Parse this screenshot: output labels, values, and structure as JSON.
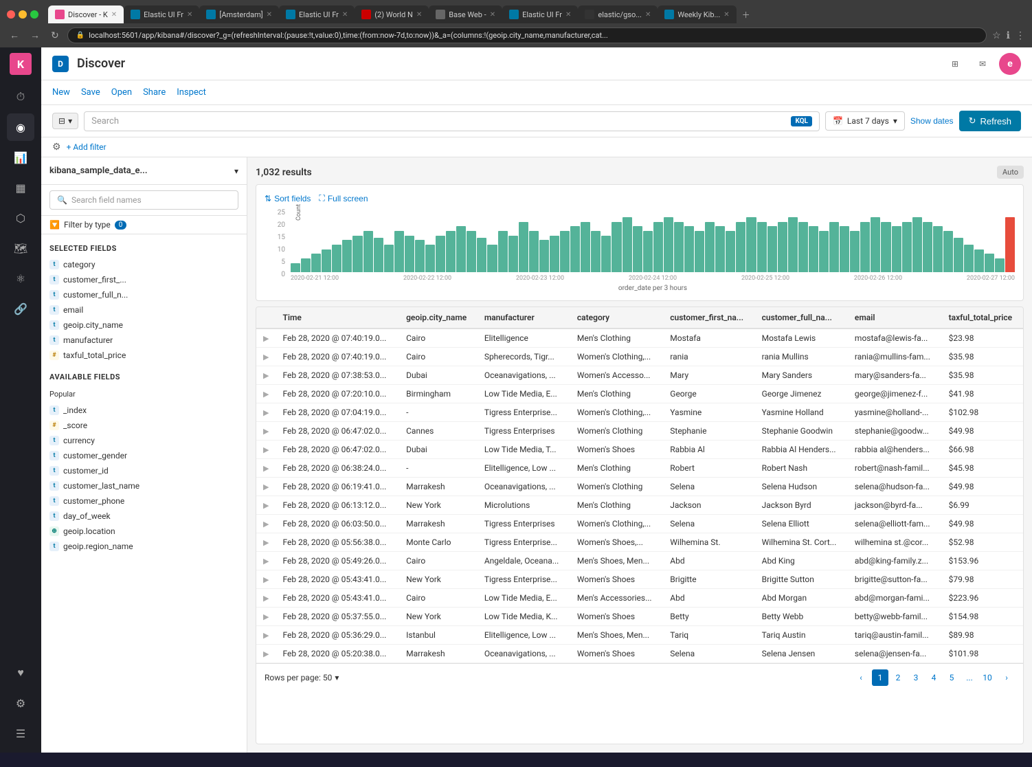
{
  "browser": {
    "url": "localhost:5601/app/kibana#/discover?_g=(refreshInterval:(pause:!t,value:0),time:(from:now-7d,to:now))&_a=(columns:!(geoip.city_name,manufacturer,cat...",
    "tabs": [
      {
        "label": "Discover - K",
        "favicon_color": "#e8478c",
        "active": true
      },
      {
        "label": "Elastic UI Fr",
        "favicon_color": "#0079a5",
        "active": false
      },
      {
        "label": "[Amsterdam]",
        "favicon_color": "#0079a5",
        "active": false
      },
      {
        "label": "Elastic UI Fr",
        "favicon_color": "#0079a5",
        "active": false
      },
      {
        "label": "(2) World N",
        "favicon_color": "#cc0000",
        "active": false
      },
      {
        "label": "Base Web -",
        "favicon_color": "#333",
        "active": false
      },
      {
        "label": "Elastic UI Fr",
        "favicon_color": "#0079a5",
        "active": false
      },
      {
        "label": "elastic/gso...",
        "favicon_color": "#333",
        "active": false
      },
      {
        "label": "Weekly Kib...",
        "favicon_color": "#0079a5",
        "active": false
      }
    ]
  },
  "app": {
    "title": "Discover",
    "nav_links": [
      "New",
      "Save",
      "Open",
      "Share",
      "Inspect"
    ],
    "search_placeholder": "Search",
    "kql_label": "KQL",
    "time_range": "Last 7 days",
    "show_dates_label": "Show dates",
    "refresh_label": "Refresh",
    "add_filter_label": "+ Add filter"
  },
  "sidebar": {
    "index_name": "kibana_sample_data_e...",
    "search_placeholder": "Search field names",
    "filter_type_label": "Filter by type",
    "filter_count": "0",
    "selected_fields_title": "Selected fields",
    "selected_fields": [
      {
        "name": "category",
        "type": "t"
      },
      {
        "name": "customer_first_...",
        "type": "t"
      },
      {
        "name": "customer_full_n...",
        "type": "t"
      },
      {
        "name": "email",
        "type": "t"
      },
      {
        "name": "geoip.city_name",
        "type": "t"
      },
      {
        "name": "manufacturer",
        "type": "t"
      },
      {
        "name": "taxful_total_price",
        "type": "hash"
      }
    ],
    "available_fields_title": "Available fields",
    "popular_title": "Popular",
    "popular_fields": [
      {
        "name": "_index",
        "type": "t"
      },
      {
        "name": "_score",
        "type": "hash"
      },
      {
        "name": "currency",
        "type": "t"
      },
      {
        "name": "customer_gender",
        "type": "t"
      },
      {
        "name": "customer_id",
        "type": "t"
      },
      {
        "name": "customer_last_name",
        "type": "t"
      },
      {
        "name": "customer_phone",
        "type": "t"
      },
      {
        "name": "day_of_week",
        "type": "t"
      },
      {
        "name": "geoip.location",
        "type": "geo"
      },
      {
        "name": "geoip.region_name",
        "type": "t"
      }
    ]
  },
  "results": {
    "count": "1,032 results",
    "auto_label": "Auto"
  },
  "chart": {
    "y_labels": [
      "25",
      "20",
      "15",
      "10",
      "5",
      "0"
    ],
    "x_labels": [
      "2020-02-21 12:00",
      "2020-02-22 12:00",
      "2020-02-23 12:00",
      "2020-02-24 12:00",
      "2020-02-25 12:00",
      "2020-02-26 12:00",
      "2020-02-27 12:00"
    ],
    "x_axis_label": "order_date per 3 hours",
    "y_axis_label": "Count",
    "sort_fields_label": "Sort fields",
    "full_screen_label": "Full screen",
    "bars": [
      4,
      6,
      8,
      10,
      12,
      14,
      16,
      18,
      15,
      12,
      18,
      16,
      14,
      12,
      16,
      18,
      20,
      18,
      15,
      12,
      18,
      16,
      22,
      18,
      14,
      16,
      18,
      20,
      22,
      18,
      16,
      22,
      24,
      20,
      18,
      22,
      24,
      22,
      20,
      18,
      22,
      20,
      18,
      22,
      24,
      22,
      20,
      22,
      24,
      22,
      20,
      18,
      22,
      20,
      18,
      22,
      24,
      22,
      20,
      22,
      24,
      22,
      20,
      18,
      15,
      12,
      10,
      8,
      6,
      24
    ]
  },
  "table": {
    "columns": [
      "Time",
      "geoip.city_name",
      "manufacturer",
      "category",
      "customer_first_na...",
      "customer_full_na...",
      "email",
      "taxful_total_price"
    ],
    "rows": [
      [
        "Feb 28, 2020 @ 07:40:19.0...",
        "Cairo",
        "Elitelligence",
        "Men's Clothing",
        "Mostafa",
        "Mostafa Lewis",
        "mostafa@lewis-fa...",
        "$23.98"
      ],
      [
        "Feb 28, 2020 @ 07:40:19.0...",
        "Cairo",
        "Spherecords, Tigr...",
        "Women's Clothing,...",
        "rania",
        "rania Mullins",
        "rania@mullins-fam...",
        "$35.98"
      ],
      [
        "Feb 28, 2020 @ 07:38:53.0...",
        "Dubai",
        "Oceanavigations, ...",
        "Women's Accesso...",
        "Mary",
        "Mary Sanders",
        "mary@sanders-fa...",
        "$35.98"
      ],
      [
        "Feb 28, 2020 @ 07:20:10.0...",
        "Birmingham",
        "Low Tide Media, E...",
        "Men's Clothing",
        "George",
        "George Jimenez",
        "george@jimenez-f...",
        "$41.98"
      ],
      [
        "Feb 28, 2020 @ 07:04:19.0...",
        "-",
        "Tigress Enterprise...",
        "Women's Clothing,...",
        "Yasmine",
        "Yasmine Holland",
        "yasmine@holland-...",
        "$102.98"
      ],
      [
        "Feb 28, 2020 @ 06:47:02.0...",
        "Cannes",
        "Tigress Enterprises",
        "Women's Clothing",
        "Stephanie",
        "Stephanie Goodwin",
        "stephanie@goodw...",
        "$49.98"
      ],
      [
        "Feb 28, 2020 @ 06:47:02.0...",
        "Dubai",
        "Low Tide Media, T...",
        "Women's Shoes",
        "Rabbia Al",
        "Rabbia Al Henders...",
        "rabbia al@henders...",
        "$66.98"
      ],
      [
        "Feb 28, 2020 @ 06:38:24.0...",
        "-",
        "Elitelligence, Low ...",
        "Men's Clothing",
        "Robert",
        "Robert Nash",
        "robert@nash-famil...",
        "$45.98"
      ],
      [
        "Feb 28, 2020 @ 06:19:41.0...",
        "Marrakesh",
        "Oceanavigations, ...",
        "Women's Clothing",
        "Selena",
        "Selena Hudson",
        "selena@hudson-fa...",
        "$49.98"
      ],
      [
        "Feb 28, 2020 @ 06:13:12.0...",
        "New York",
        "Microlutions",
        "Men's Clothing",
        "Jackson",
        "Jackson Byrd",
        "jackson@byrd-fa...",
        "$6.99"
      ],
      [
        "Feb 28, 2020 @ 06:03:50.0...",
        "Marrakesh",
        "Tigress Enterprises",
        "Women's Clothing,...",
        "Selena",
        "Selena Elliott",
        "selena@elliott-fam...",
        "$49.98"
      ],
      [
        "Feb 28, 2020 @ 05:56:38.0...",
        "Monte Carlo",
        "Tigress Enterprise...",
        "Women's Shoes,...",
        "Wilhemina St.",
        "Wilhemina St. Cort...",
        "wilhemina st.@cor...",
        "$52.98"
      ],
      [
        "Feb 28, 2020 @ 05:49:26.0...",
        "Cairo",
        "Angeldale, Oceana...",
        "Men's Shoes, Men...",
        "Abd",
        "Abd King",
        "abd@king-family.z...",
        "$153.96"
      ],
      [
        "Feb 28, 2020 @ 05:43:41.0...",
        "New York",
        "Tigress Enterprise...",
        "Women's Shoes",
        "Brigitte",
        "Brigitte Sutton",
        "brigitte@sutton-fa...",
        "$79.98"
      ],
      [
        "Feb 28, 2020 @ 05:43:41.0...",
        "Cairo",
        "Low Tide Media, E...",
        "Men's Accessories...",
        "Abd",
        "Abd Morgan",
        "abd@morgan-fami...",
        "$223.96"
      ],
      [
        "Feb 28, 2020 @ 05:37:55.0...",
        "New York",
        "Low Tide Media, K...",
        "Women's Shoes",
        "Betty",
        "Betty Webb",
        "betty@webb-famil...",
        "$154.98"
      ],
      [
        "Feb 28, 2020 @ 05:36:29.0...",
        "Istanbul",
        "Elitelligence, Low ...",
        "Men's Shoes, Men...",
        "Tariq",
        "Tariq Austin",
        "tariq@austin-famil...",
        "$89.98"
      ],
      [
        "Feb 28, 2020 @ 05:20:38.0...",
        "Marrakesh",
        "Oceanavigations, ...",
        "Women's Shoes",
        "Selena",
        "Selena Jensen",
        "selena@jensen-fa...",
        "$101.98"
      ]
    ],
    "footer": {
      "rows_per_page_label": "Rows per page: 50",
      "pages": [
        "1",
        "2",
        "3",
        "4",
        "5",
        "...",
        "10"
      ],
      "active_page": "1"
    }
  },
  "nav_rail": {
    "items": [
      {
        "icon": "⏱",
        "name": "recent"
      },
      {
        "icon": "◉",
        "name": "discover"
      },
      {
        "icon": "📊",
        "name": "visualize"
      },
      {
        "icon": "📋",
        "name": "dashboard"
      },
      {
        "icon": "⚙",
        "name": "canvas"
      },
      {
        "icon": "🗺",
        "name": "maps"
      },
      {
        "icon": "👤",
        "name": "ml"
      },
      {
        "icon": "🔗",
        "name": "graph"
      },
      {
        "icon": "♥",
        "name": "apm"
      },
      {
        "icon": "⚙",
        "name": "settings"
      }
    ]
  }
}
